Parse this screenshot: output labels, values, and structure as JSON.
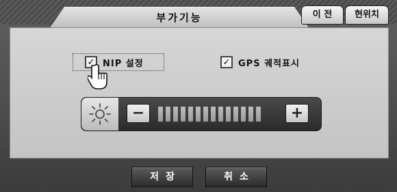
{
  "header": {
    "title": "부가기능",
    "prev_label": "이 전",
    "location_label": "현위치"
  },
  "options": {
    "nip": {
      "label": "NIP 설정",
      "checked": true,
      "mark": "✓"
    },
    "gps": {
      "label": "GPS 궤적표시",
      "checked": true,
      "mark": "✓"
    }
  },
  "brightness": {
    "minus_label": "−",
    "plus_label": "+",
    "segments": 14
  },
  "footer": {
    "save_label": "저장",
    "cancel_label": "취소"
  }
}
